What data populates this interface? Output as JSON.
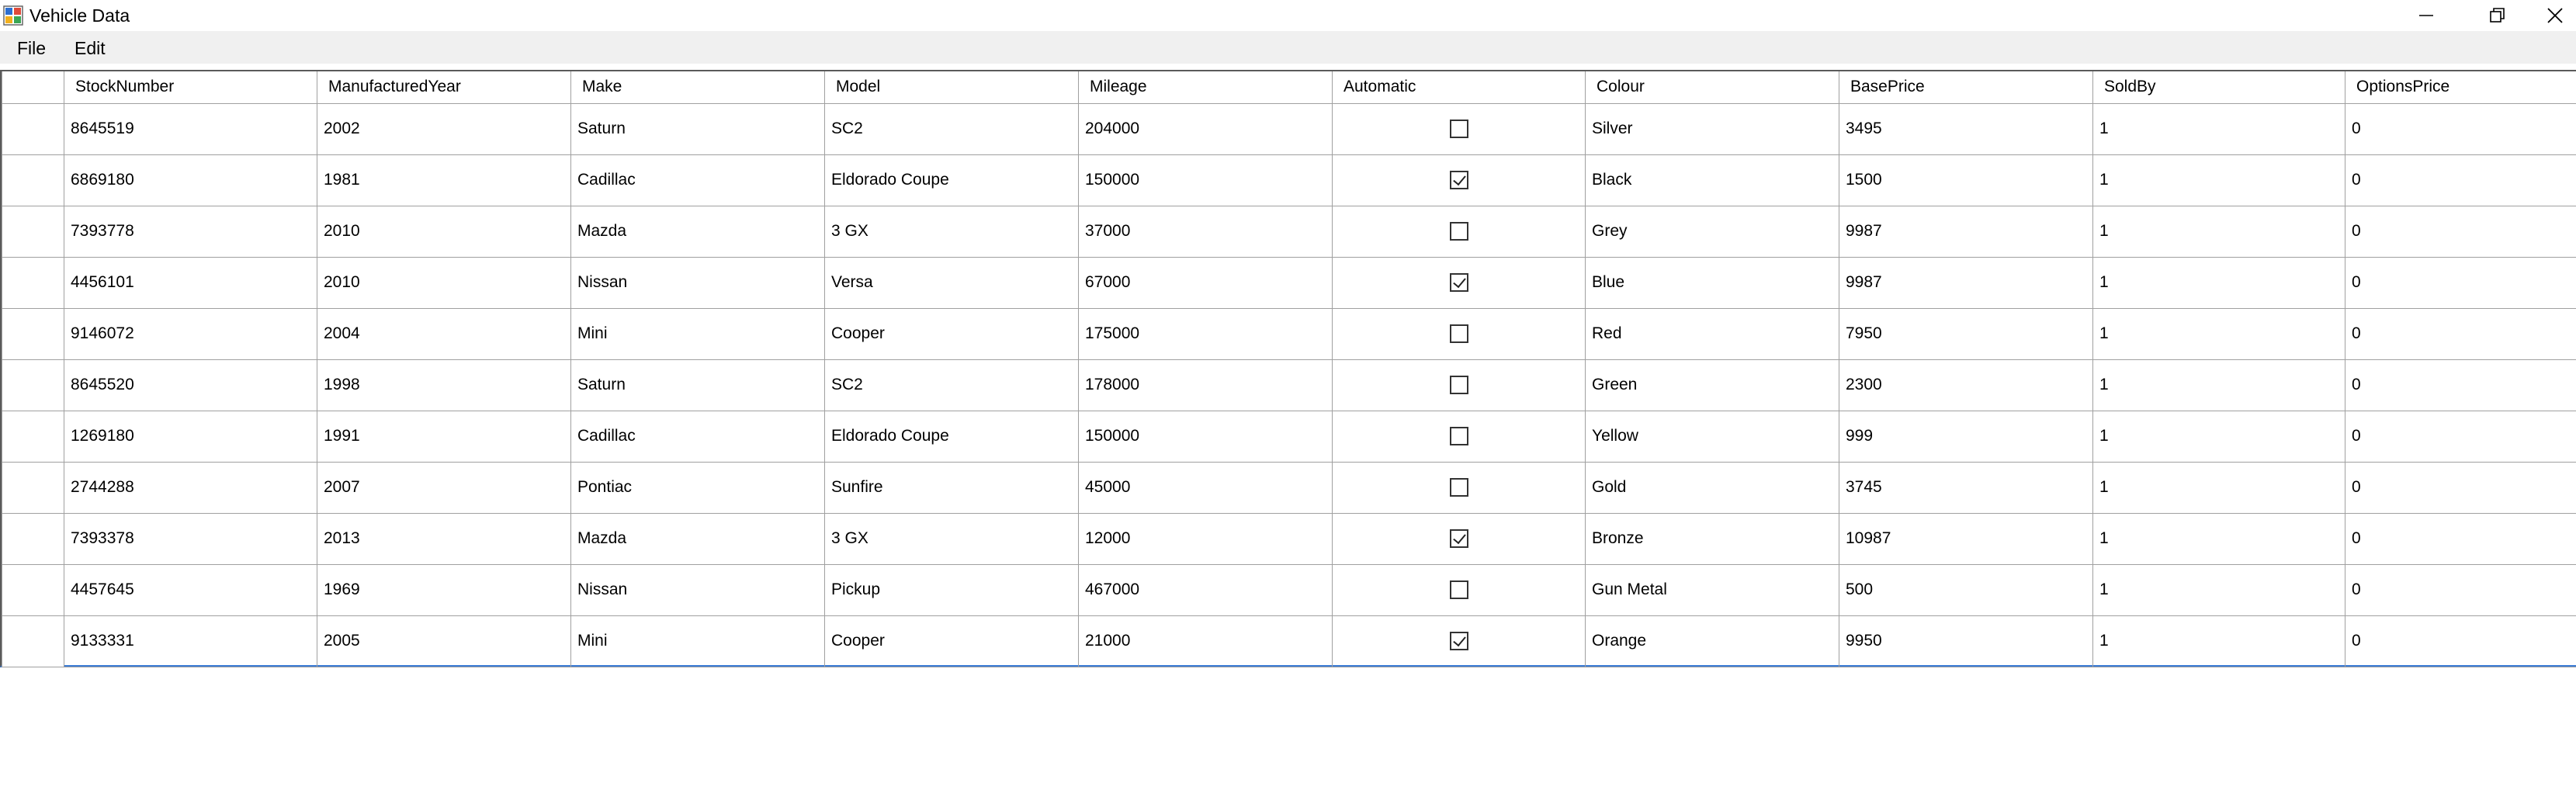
{
  "window": {
    "title": "Vehicle Data",
    "icon": "app-grid-icon"
  },
  "menu": {
    "file_label": "File",
    "edit_label": "Edit"
  },
  "columns": [
    "StockNumber",
    "ManufacturedYear",
    "Make",
    "Model",
    "Mileage",
    "Automatic",
    "Colour",
    "BasePrice",
    "SoldBy",
    "OptionsPrice"
  ],
  "rows": [
    {
      "StockNumber": "8645519",
      "ManufacturedYear": "2002",
      "Make": "Saturn",
      "Model": "SC2",
      "Mileage": "204000",
      "Automatic": false,
      "Colour": "Silver",
      "BasePrice": "3495",
      "SoldBy": "1",
      "OptionsPrice": "0"
    },
    {
      "StockNumber": "6869180",
      "ManufacturedYear": "1981",
      "Make": "Cadillac",
      "Model": "Eldorado Coupe",
      "Mileage": "150000",
      "Automatic": true,
      "Colour": "Black",
      "BasePrice": "1500",
      "SoldBy": "1",
      "OptionsPrice": "0"
    },
    {
      "StockNumber": "7393778",
      "ManufacturedYear": "2010",
      "Make": "Mazda",
      "Model": "3 GX",
      "Mileage": "37000",
      "Automatic": false,
      "Colour": "Grey",
      "BasePrice": "9987",
      "SoldBy": "1",
      "OptionsPrice": "0"
    },
    {
      "StockNumber": "4456101",
      "ManufacturedYear": "2010",
      "Make": "Nissan",
      "Model": "Versa",
      "Mileage": "67000",
      "Automatic": true,
      "Colour": "Blue",
      "BasePrice": "9987",
      "SoldBy": "1",
      "OptionsPrice": "0"
    },
    {
      "StockNumber": "9146072",
      "ManufacturedYear": "2004",
      "Make": "Mini",
      "Model": "Cooper",
      "Mileage": "175000",
      "Automatic": false,
      "Colour": "Red",
      "BasePrice": "7950",
      "SoldBy": "1",
      "OptionsPrice": "0"
    },
    {
      "StockNumber": "8645520",
      "ManufacturedYear": "1998",
      "Make": "Saturn",
      "Model": "SC2",
      "Mileage": "178000",
      "Automatic": false,
      "Colour": "Green",
      "BasePrice": "2300",
      "SoldBy": "1",
      "OptionsPrice": "0"
    },
    {
      "StockNumber": "1269180",
      "ManufacturedYear": "1991",
      "Make": "Cadillac",
      "Model": "Eldorado Coupe",
      "Mileage": "150000",
      "Automatic": false,
      "Colour": "Yellow",
      "BasePrice": "999",
      "SoldBy": "1",
      "OptionsPrice": "0"
    },
    {
      "StockNumber": "2744288",
      "ManufacturedYear": "2007",
      "Make": "Pontiac",
      "Model": "Sunfire",
      "Mileage": "45000",
      "Automatic": false,
      "Colour": "Gold",
      "BasePrice": "3745",
      "SoldBy": "1",
      "OptionsPrice": "0"
    },
    {
      "StockNumber": "7393378",
      "ManufacturedYear": "2013",
      "Make": "Mazda",
      "Model": "3 GX",
      "Mileage": "12000",
      "Automatic": true,
      "Colour": "Bronze",
      "BasePrice": "10987",
      "SoldBy": "1",
      "OptionsPrice": "0"
    },
    {
      "StockNumber": "4457645",
      "ManufacturedYear": "1969",
      "Make": "Nissan",
      "Model": "Pickup",
      "Mileage": "467000",
      "Automatic": false,
      "Colour": "Gun Metal",
      "BasePrice": "500",
      "SoldBy": "1",
      "OptionsPrice": "0"
    },
    {
      "StockNumber": "9133331",
      "ManufacturedYear": "2005",
      "Make": "Mini",
      "Model": "Cooper",
      "Mileage": "21000",
      "Automatic": true,
      "Colour": "Orange",
      "BasePrice": "9950",
      "SoldBy": "1",
      "OptionsPrice": "0"
    }
  ],
  "colors": {
    "menu_bg": "#f0f0f0",
    "grid_line": "#a0a0a0",
    "selection_accent": "#3a7bd5"
  }
}
